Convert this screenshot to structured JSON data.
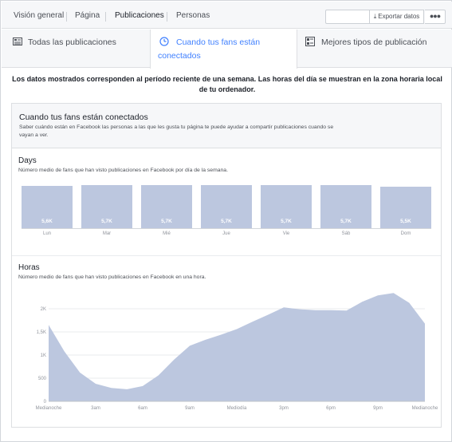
{
  "tabs": {
    "overview": "Visión general",
    "page": "Página",
    "posts": "Publicaciones",
    "people": "Personas"
  },
  "toolbar": {
    "export_label": "Exportar datos",
    "more_label": "●●●"
  },
  "subtabs": {
    "all_posts": "Todas las publicaciones",
    "when_online": "Cuando tus fans están conectados",
    "best_types": "Mejores tipos de publicación"
  },
  "notice": "Los datos mostrados corresponden al período reciente de una semana. Las horas del día se muestran en la zona horaria local de tu ordenador.",
  "panel": {
    "title": "Cuando tus fans están conectados",
    "description": "Saber cuándo están en Facebook las personas a las que les gusta tu página te puede ayudar a compartir publicaciones cuando se vayan a ver."
  },
  "days": {
    "title": "Days",
    "description": "Número medio de fans que han visto publicaciones en Facebook por día de la semana."
  },
  "hours": {
    "title": "Horas",
    "description": "Número medio de fans que han visto publicaciones en Facebook en una hora."
  },
  "colors": {
    "accent": "#4080ff",
    "bar": "#bcc7df",
    "area": "#bcc7df"
  },
  "chart_data": [
    {
      "type": "bar",
      "categories": [
        "Lun",
        "Mar",
        "Mié",
        "Jue",
        "Vie",
        "Sáb",
        "Dom"
      ],
      "value_labels": [
        "5,6K",
        "5,7K",
        "5,7K",
        "5,7K",
        "5,7K",
        "5,7K",
        "5,5K"
      ],
      "values": [
        5600,
        5700,
        5700,
        5700,
        5700,
        5700,
        5500
      ]
    },
    {
      "type": "area",
      "x": [
        0,
        1,
        2,
        3,
        4,
        5,
        6,
        7,
        8,
        9,
        10,
        11,
        12,
        13,
        14,
        15,
        16,
        17,
        18,
        19,
        20,
        21,
        22,
        23
      ],
      "y": [
        1650,
        1080,
        620,
        380,
        290,
        260,
        330,
        560,
        900,
        1200,
        1330,
        1440,
        1560,
        1720,
        1870,
        2030,
        1990,
        1970,
        1970,
        1960,
        2150,
        2290,
        2340,
        2130,
        1680
      ],
      "x_tick_labels": [
        "Medianoche",
        "3am",
        "6am",
        "9am",
        "Mediodía",
        "3pm",
        "6pm",
        "9pm",
        "Medianoche"
      ],
      "y_tick_labels": [
        "0",
        "500",
        "1K",
        "1,5K",
        "2K"
      ],
      "ylim": [
        0,
        2500
      ]
    }
  ]
}
